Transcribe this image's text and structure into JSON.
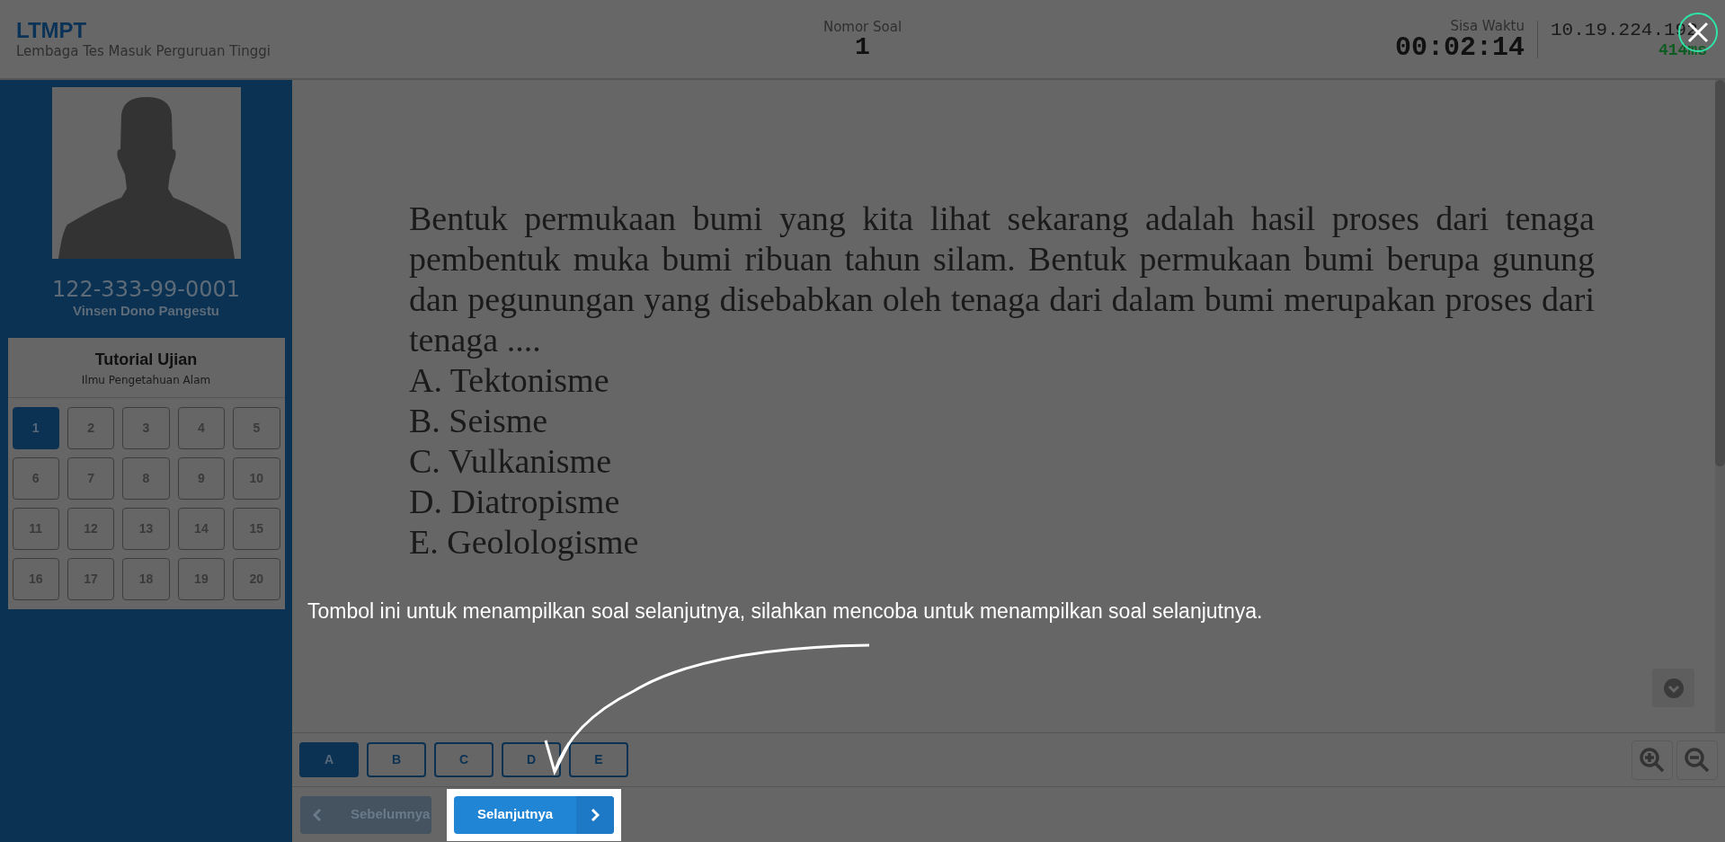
{
  "header": {
    "logo": "LTMPT",
    "subtitle": "Lembaga Tes Masuk Perguruan Tinggi"
  },
  "question_number": {
    "label": "Nomor Soal",
    "value": "1"
  },
  "timer": {
    "label": "Sisa Waktu",
    "value": "00:02:14"
  },
  "connection": {
    "ip": "10.19.224.192",
    "latency": "414ms"
  },
  "participant": {
    "id": "122-333-99-0001",
    "name": "Vinsen Dono Pangestu"
  },
  "panel": {
    "title": "Tutorial Ujian",
    "subtitle": "Ilmu Pengetahuan Alam",
    "questions": [
      {
        "label": "1",
        "selected": true
      },
      {
        "label": "2",
        "selected": false
      },
      {
        "label": "3",
        "selected": false
      },
      {
        "label": "4",
        "selected": false
      },
      {
        "label": "5",
        "selected": false
      },
      {
        "label": "6",
        "selected": false
      },
      {
        "label": "7",
        "selected": false
      },
      {
        "label": "8",
        "selected": false
      },
      {
        "label": "9",
        "selected": false
      },
      {
        "label": "10",
        "selected": false
      },
      {
        "label": "11",
        "selected": false
      },
      {
        "label": "12",
        "selected": false
      },
      {
        "label": "13",
        "selected": false
      },
      {
        "label": "14",
        "selected": false
      },
      {
        "label": "15",
        "selected": false
      },
      {
        "label": "16",
        "selected": false
      },
      {
        "label": "17",
        "selected": false
      },
      {
        "label": "18",
        "selected": false
      },
      {
        "label": "19",
        "selected": false
      },
      {
        "label": "20",
        "selected": false
      }
    ]
  },
  "question": {
    "stem": "Bentuk permukaan bumi yang kita lihat sekarang adalah hasil proses dari tenaga pembentuk muka bumi ribuan tahun silam. Bentuk permukaan bumi berupa gunung dan pegunungan yang disebabkan oleh tenaga dari dalam bumi merupakan proses dari tenaga ....",
    "choices": [
      "A. Tektonisme",
      "B. Seisme",
      "C. Vulkanisme",
      "D. Diatropisme",
      "E. Geolologisme"
    ]
  },
  "answers": [
    {
      "label": "A",
      "selected": true
    },
    {
      "label": "B",
      "selected": false
    },
    {
      "label": "C",
      "selected": false
    },
    {
      "label": "D",
      "selected": false
    },
    {
      "label": "E",
      "selected": false
    }
  ],
  "nav": {
    "previous": {
      "label": "Sebelumnya",
      "disabled": true
    },
    "next": {
      "label": "Selanjutnya",
      "disabled": false
    }
  },
  "tooltip": "Tombol ini untuk menampilkan soal selanjutnya, silahkan mencoba untuk menampilkan soal selanjutnya."
}
